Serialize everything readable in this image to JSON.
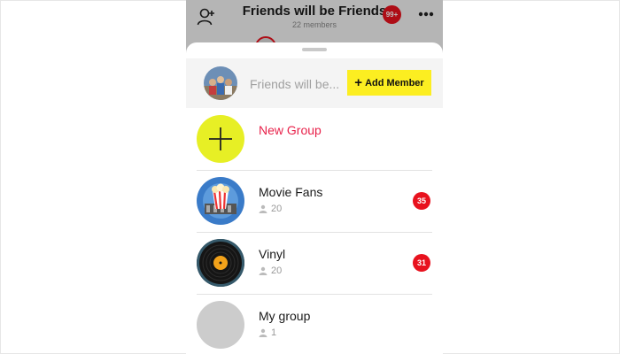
{
  "header": {
    "title": "Friends will be Friends",
    "subtitle": "22 members",
    "badge": "99+",
    "icons": [
      "add-person-icon",
      "more-icon"
    ]
  },
  "sheet": {
    "group_name": "Friends will be...",
    "add_member_label": "Add Member"
  },
  "items": [
    {
      "name": "New Group",
      "icon": "plus-icon"
    },
    {
      "name": "Movie Fans",
      "members": "20",
      "unread": "35"
    },
    {
      "name": "Vinyl",
      "members": "20",
      "unread": "31"
    },
    {
      "name": "My group",
      "members": "1"
    }
  ],
  "colors": {
    "accent_yellow": "#fcee21",
    "badge_red": "#e8121e",
    "new_group_text": "#e8214a"
  }
}
